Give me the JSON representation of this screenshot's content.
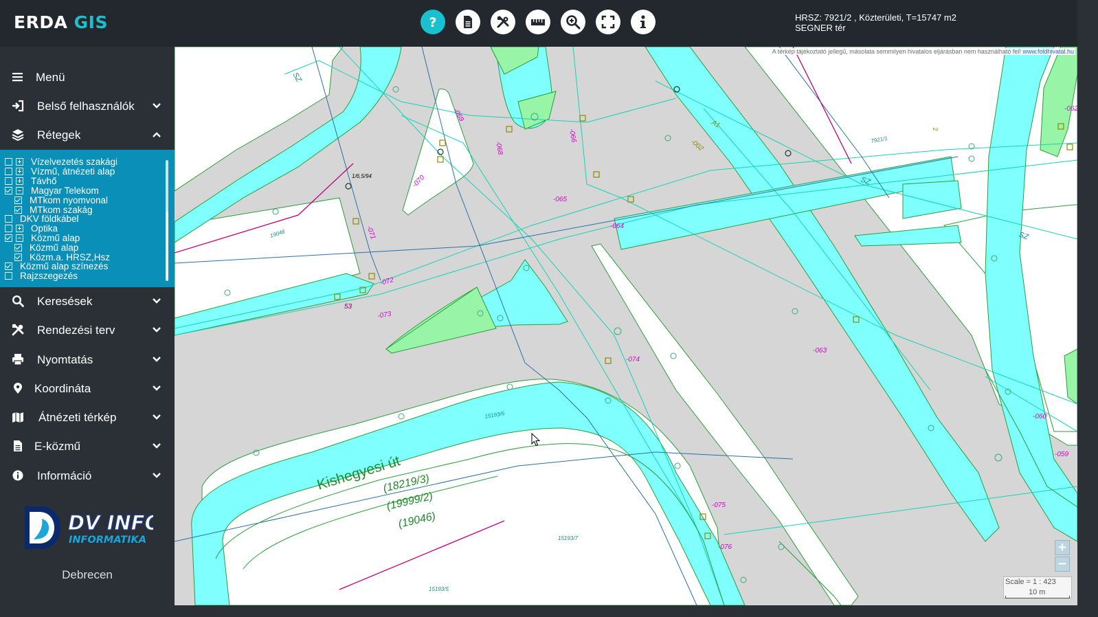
{
  "app": {
    "brand": "ERDA",
    "brand_accent": "GIS"
  },
  "toolbar": {
    "tools": [
      {
        "name": "help-icon"
      },
      {
        "name": "document-icon"
      },
      {
        "name": "tools-icon"
      },
      {
        "name": "ruler-icon"
      },
      {
        "name": "zoom-icon"
      },
      {
        "name": "fullscreen-icon"
      },
      {
        "name": "info-icon"
      }
    ]
  },
  "parcel_info": {
    "line1": "HRSZ: 7921/2 , Közterületi, T=15747 m2",
    "line2": "SEGNER tér"
  },
  "sidebar": {
    "menu": "Menü",
    "belso": "Belső felhasználók",
    "retegek": "Rétegek",
    "keresesek": "Keresések",
    "rendezesi": "Rendezési terv",
    "nyomtatas": "Nyomtatás",
    "koordinata": "Koordináta",
    "atnezeti": "Átnézeti térkép",
    "ekozmu": "E-közmű",
    "informacio": "Információ"
  },
  "layers": [
    {
      "label": "Vízelvezetés szakági",
      "checked": false,
      "expander": "plus"
    },
    {
      "label": "Vízmű, átnézeti alap",
      "checked": false,
      "expander": "plus"
    },
    {
      "label": "Távhő",
      "checked": false,
      "expander": "plus"
    },
    {
      "label": "Magyar Telekom",
      "checked": true,
      "expander": "minus"
    },
    {
      "label": "MTkom nyomvonal",
      "checked": true
    },
    {
      "label": "MTkom szakág",
      "checked": true
    },
    {
      "label": "DKV földkábel",
      "checked": false
    },
    {
      "label": "Optika",
      "checked": false,
      "expander": "plus"
    },
    {
      "label": "Közmű alap",
      "checked": true,
      "expander": "minus"
    },
    {
      "label": "Közmű alap",
      "checked": true
    },
    {
      "label": "Közm.a. HRSZ,Hsz",
      "checked": true
    },
    {
      "label": "Közmű alap színezés",
      "checked": true
    },
    {
      "label": "Rajzszegezés",
      "checked": false
    }
  ],
  "footer": {
    "logo_main": "DV INFO",
    "logo_sub": "INFORMATIKA",
    "city": "Debrecen"
  },
  "map": {
    "disclaimer": "A térkép tájékoztató jellegű, másolata semmilyen hivatalos eljárásban nem használható fel!",
    "disclaimer_link": "www.foldhivatal.hu",
    "street_name": "Kishegyesi út",
    "parcel_labels": [
      "(18219/3)",
      "(19999/2)",
      "(19046)"
    ],
    "small_labels": [
      "7921/1",
      "15193/7",
      "15193/5",
      "15193/6",
      "19046",
      "1/6,5/94",
      "53",
      "A1",
      "2",
      "SZ",
      "SZ",
      "SZ"
    ],
    "point_labels": [
      "-069",
      "-068",
      "-066",
      "-070",
      "-065",
      "-064",
      "-071",
      "-072",
      "-073",
      "-074",
      "-063",
      "-062",
      "-060",
      "-059",
      "-075",
      "-076",
      "-002"
    ],
    "scale_text": "Scale = 1 : 423",
    "scale_bar": "10 m",
    "zoom_in": "+",
    "zoom_out": "−"
  },
  "colors": {
    "utility_fill": "#80ffff",
    "green_fill": "#98f5a8",
    "road_line": "#2a9d3a",
    "point_label": "#d400d4"
  }
}
